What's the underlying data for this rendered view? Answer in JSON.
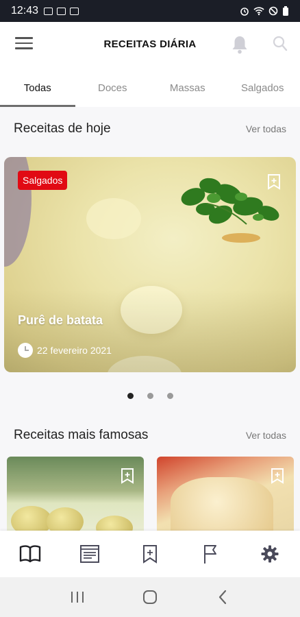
{
  "status_bar": {
    "time": "12:43"
  },
  "app_bar": {
    "title": "RECEITAS DIÁRIA"
  },
  "tabs": [
    {
      "label": "Todas",
      "active": true
    },
    {
      "label": "Doces",
      "active": false
    },
    {
      "label": "Massas",
      "active": false
    },
    {
      "label": "Salgados",
      "active": false
    }
  ],
  "today": {
    "title": "Receitas de hoje",
    "see_all": "Ver todas",
    "featured": {
      "badge": "Salgados",
      "name": "Purê de batata",
      "date": "22 fevereiro 2021"
    },
    "carousel": {
      "count": 3,
      "active_index": 0
    }
  },
  "famous": {
    "title": "Receitas mais famosas",
    "see_all": "Ver todas"
  },
  "bottom_nav": [
    "book-icon",
    "newspaper-icon",
    "bookmark-icon",
    "flag-icon",
    "gear-icon"
  ],
  "colors": {
    "badge": "#e10a14",
    "status_bar": "#1b1e27",
    "nav_icon": "#4a4a5a"
  }
}
